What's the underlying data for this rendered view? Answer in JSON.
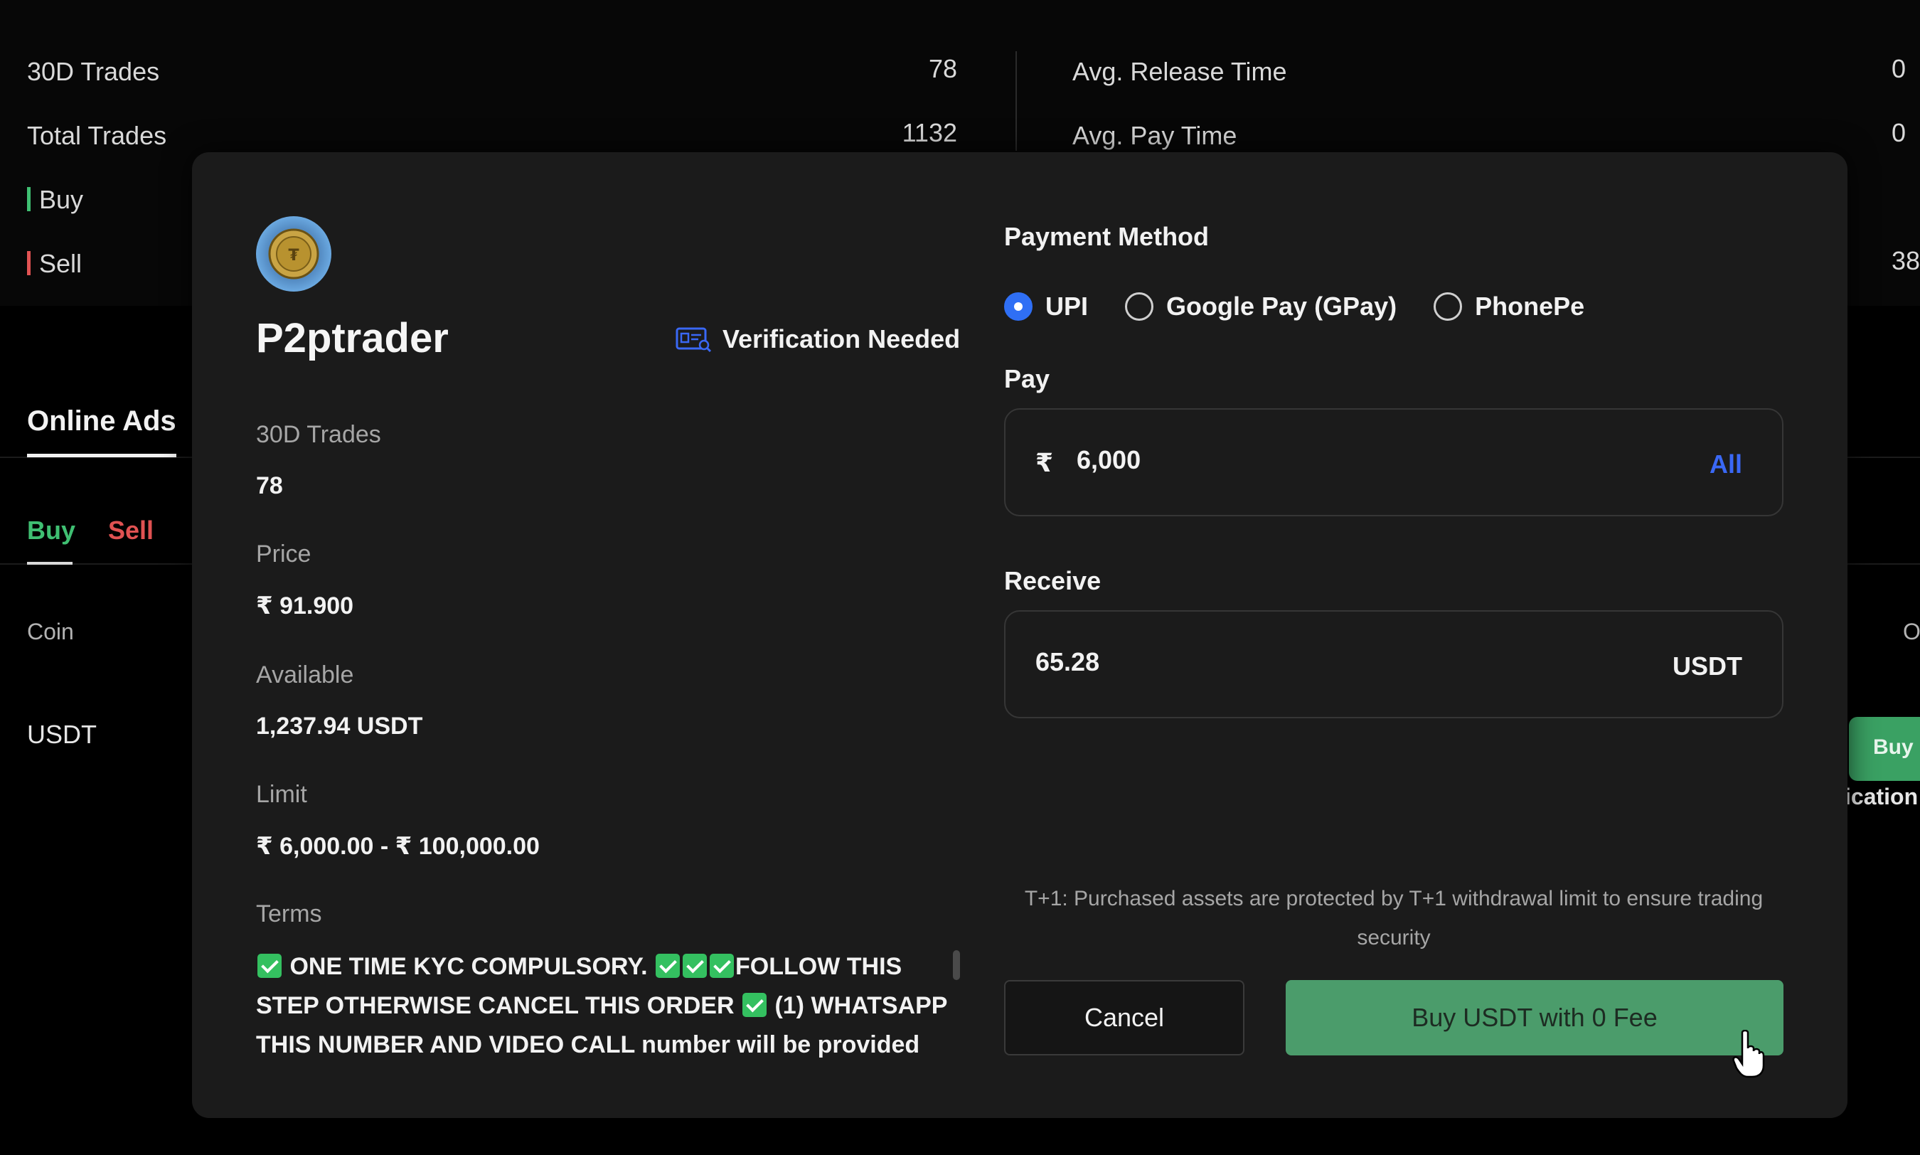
{
  "background": {
    "stats_left": [
      {
        "label": "30D Trades",
        "value": "78"
      },
      {
        "label": "Total Trades",
        "value": "1132"
      }
    ],
    "buy_label": "Buy",
    "sell_label": "Sell",
    "stats_right": [
      {
        "label": "Avg. Release Time",
        "value": "0"
      },
      {
        "label": "Avg. Pay Time",
        "value": "0"
      }
    ],
    "right_partial_value": "38",
    "online_ads_tab": "Online Ads",
    "side_tabs": {
      "buy": "Buy",
      "sell": "Sell"
    },
    "coin_header": "Coin",
    "coin_value": "USDT",
    "right_header_partial": "O",
    "buy_button_partial": "Buy",
    "right_text_partial": "ication"
  },
  "modal": {
    "trader": {
      "name": "P2ptrader",
      "avatar_icon": "coin-avatar",
      "verification_badge": "Verification Needed"
    },
    "fields": [
      {
        "label": "30D Trades",
        "value": "78"
      },
      {
        "label": "Price",
        "value": "₹ 91.900"
      },
      {
        "label": "Available",
        "value": "1,237.94 USDT"
      },
      {
        "label": "Limit",
        "value": "₹ 6,000.00 - ₹ 100,000.00"
      }
    ],
    "terms_label": "Terms",
    "terms": {
      "p1": "ONE TIME KYC COMPULSORY.",
      "p2": "FOLLOW THIS STEP OTHERWISE CANCEL THIS ORDER",
      "p3": "(1) WHATSAPP THIS NUMBER AND VIDEO CALL number will be provided"
    },
    "payment": {
      "title": "Payment Method",
      "options": [
        "UPI",
        "Google Pay (GPay)",
        "PhonePe"
      ],
      "selected": "UPI"
    },
    "pay": {
      "label": "Pay",
      "currency_symbol": "₹",
      "value": "6,000",
      "all_link": "All"
    },
    "receive": {
      "label": "Receive",
      "value": "65.28",
      "unit": "USDT"
    },
    "note": "T+1: Purchased assets are protected by T+1 withdrawal limit to ensure trading security",
    "buttons": {
      "cancel": "Cancel",
      "buy": "Buy USDT with 0 Fee"
    },
    "colors": {
      "accent_blue": "#2f6ff5",
      "buy_green": "#4b9c6b",
      "sell_red": "#e05252",
      "positive_green": "#3fbf72"
    }
  }
}
